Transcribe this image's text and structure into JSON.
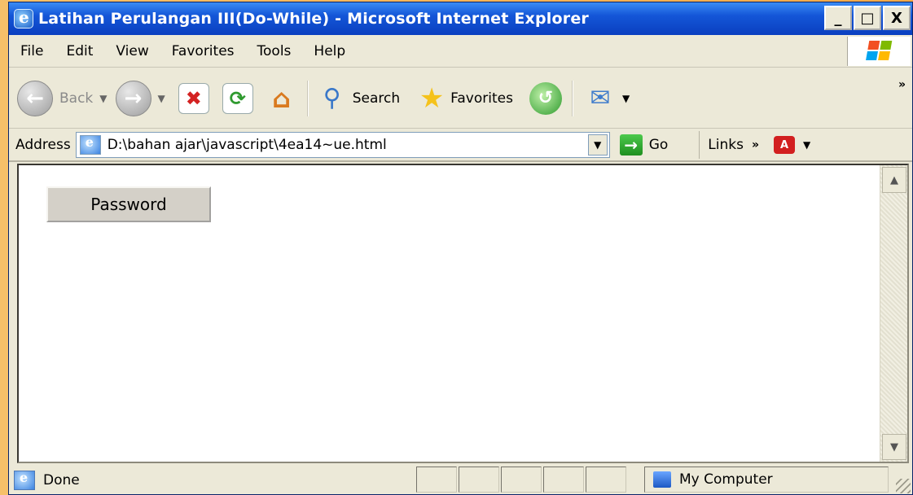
{
  "window": {
    "title": "Latihan Perulangan III(Do-While) - Microsoft Internet Explorer",
    "buttons": [
      "_",
      "□",
      "X"
    ]
  },
  "menu": [
    "File",
    "Edit",
    "View",
    "Favorites",
    "Tools",
    "Help"
  ],
  "toolbar": {
    "back_label": "Back",
    "search_label": "Search",
    "favorites_label": "Favorites",
    "chevron": "»"
  },
  "address": {
    "label": "Address",
    "value": "D:\\bahan ajar\\javascript\\4ea14~ue.html",
    "go_label": "Go",
    "links_label": "Links",
    "links_chevron": "»"
  },
  "content": {
    "password_button": "Password"
  },
  "status": {
    "text": "Done",
    "zone": "My Computer"
  },
  "colors": {
    "titlebar": "#0a3fc0",
    "chrome": "#ece9d8",
    "background": "#f4b860"
  }
}
